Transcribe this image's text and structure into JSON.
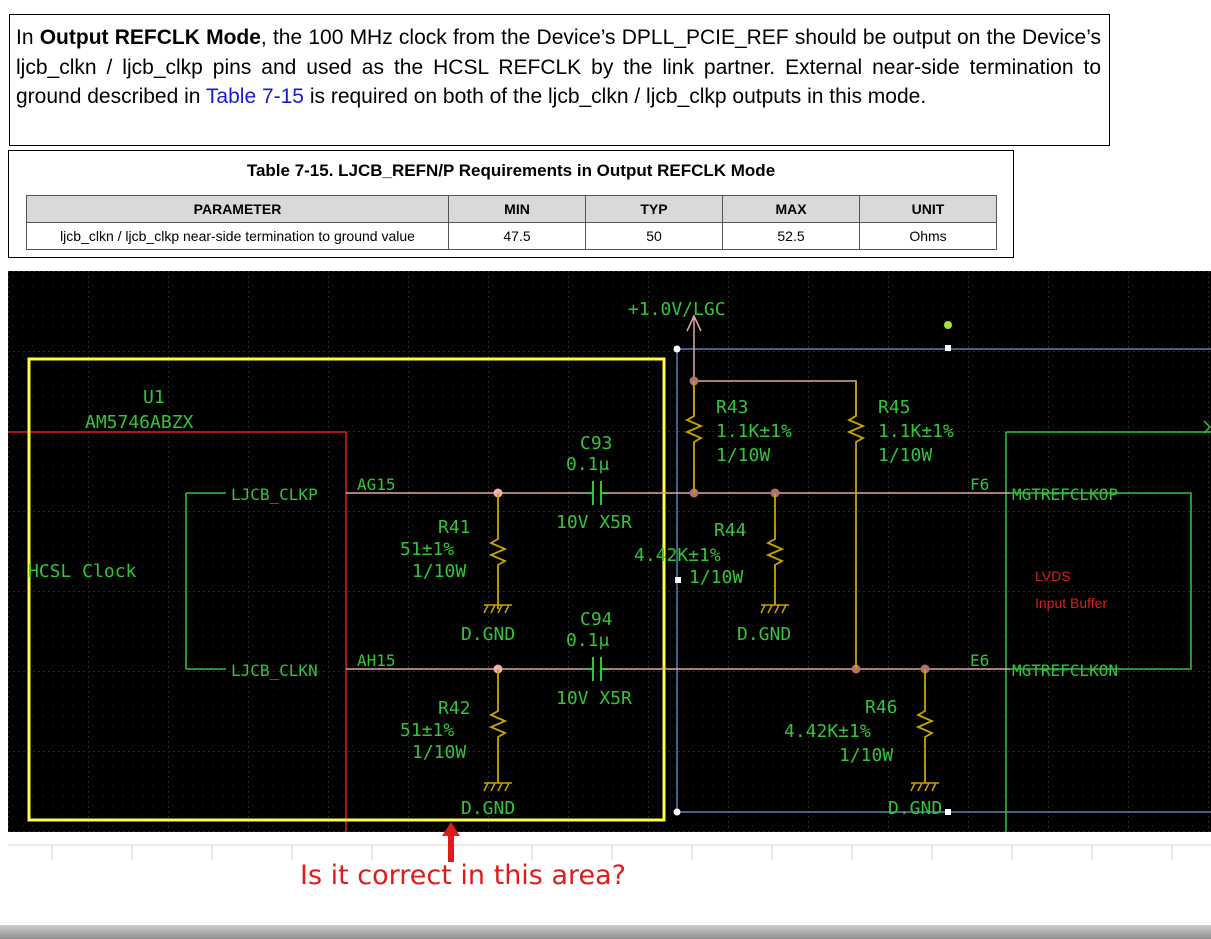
{
  "paragraph": {
    "part1": "In ",
    "bold": "Output REFCLK Mode",
    "part2": ", the 100 MHz clock from the Device’s DPLL_PCIE_REF should be output on the Device’s ljcb_clkn / ljcb_clkp pins and used as the HCSL REFCLK by the link partner. External near-side termination to ground described in ",
    "link": "Table 7-15",
    "part3": " is required on both of the ljcb_clkn / ljcb_clkp outputs in this mode."
  },
  "table": {
    "title": "Table 7-15. LJCB_REFN/P Requirements in Output REFCLK Mode",
    "headers": [
      "PARAMETER",
      "MIN",
      "TYP",
      "MAX",
      "UNIT"
    ],
    "rows": [
      [
        "ljcb_clkn / ljcb_clkp near-side termination to ground value",
        "47.5",
        "50",
        "52.5",
        "Ohms"
      ]
    ]
  },
  "schematic": {
    "power_rail": "+1.0V/LGC",
    "u1_ref": "U1",
    "u1_part": "AM5746ABZX",
    "u1_block": "HCSL Clock",
    "pin_clkp": "LJCB_CLKP",
    "pin_clkn": "LJCB_CLKN",
    "ball_clkp": "AG15",
    "ball_clkn": "AH15",
    "c93": {
      "ref": "C93",
      "value": "0.1μ",
      "rating": "10V X5R"
    },
    "c94": {
      "ref": "C94",
      "value": "0.1μ",
      "rating": "10V X5R"
    },
    "r41": {
      "ref": "R41",
      "value": "51±1%",
      "power": "1/10W"
    },
    "r42": {
      "ref": "R42",
      "value": "51±1%",
      "power": "1/10W"
    },
    "r43": {
      "ref": "R43",
      "value": "1.1K±1%",
      "power": "1/10W"
    },
    "r45": {
      "ref": "R45",
      "value": "1.1K±1%",
      "power": "1/10W"
    },
    "r44": {
      "ref": "R44",
      "value": "4.42K±1%",
      "power": "1/10W"
    },
    "r46": {
      "ref": "R46",
      "value": "4.42K±1%",
      "power": "1/10W"
    },
    "gnd": "D.GND",
    "ball_f6": "F6",
    "ball_e6": "E6",
    "net_p": "MGTREFCLKOP",
    "net_n": "MGTREFCLKON",
    "lvds_line1": "LVDS",
    "lvds_line2": "Input  Buffer"
  },
  "question": "Is it correct in this area?",
  "colors": {
    "schematic_bg": "#000000",
    "component_green": "#34c43a",
    "wire_pink": "#e3a6a6",
    "resistor_gold": "#c8a400",
    "highlight_yellow": "#ffff40",
    "device_red": "#d81f1f",
    "region_blue": "#5b7fb5",
    "question_red": "#e01b1b",
    "link_blue": "#1a1ad6"
  }
}
